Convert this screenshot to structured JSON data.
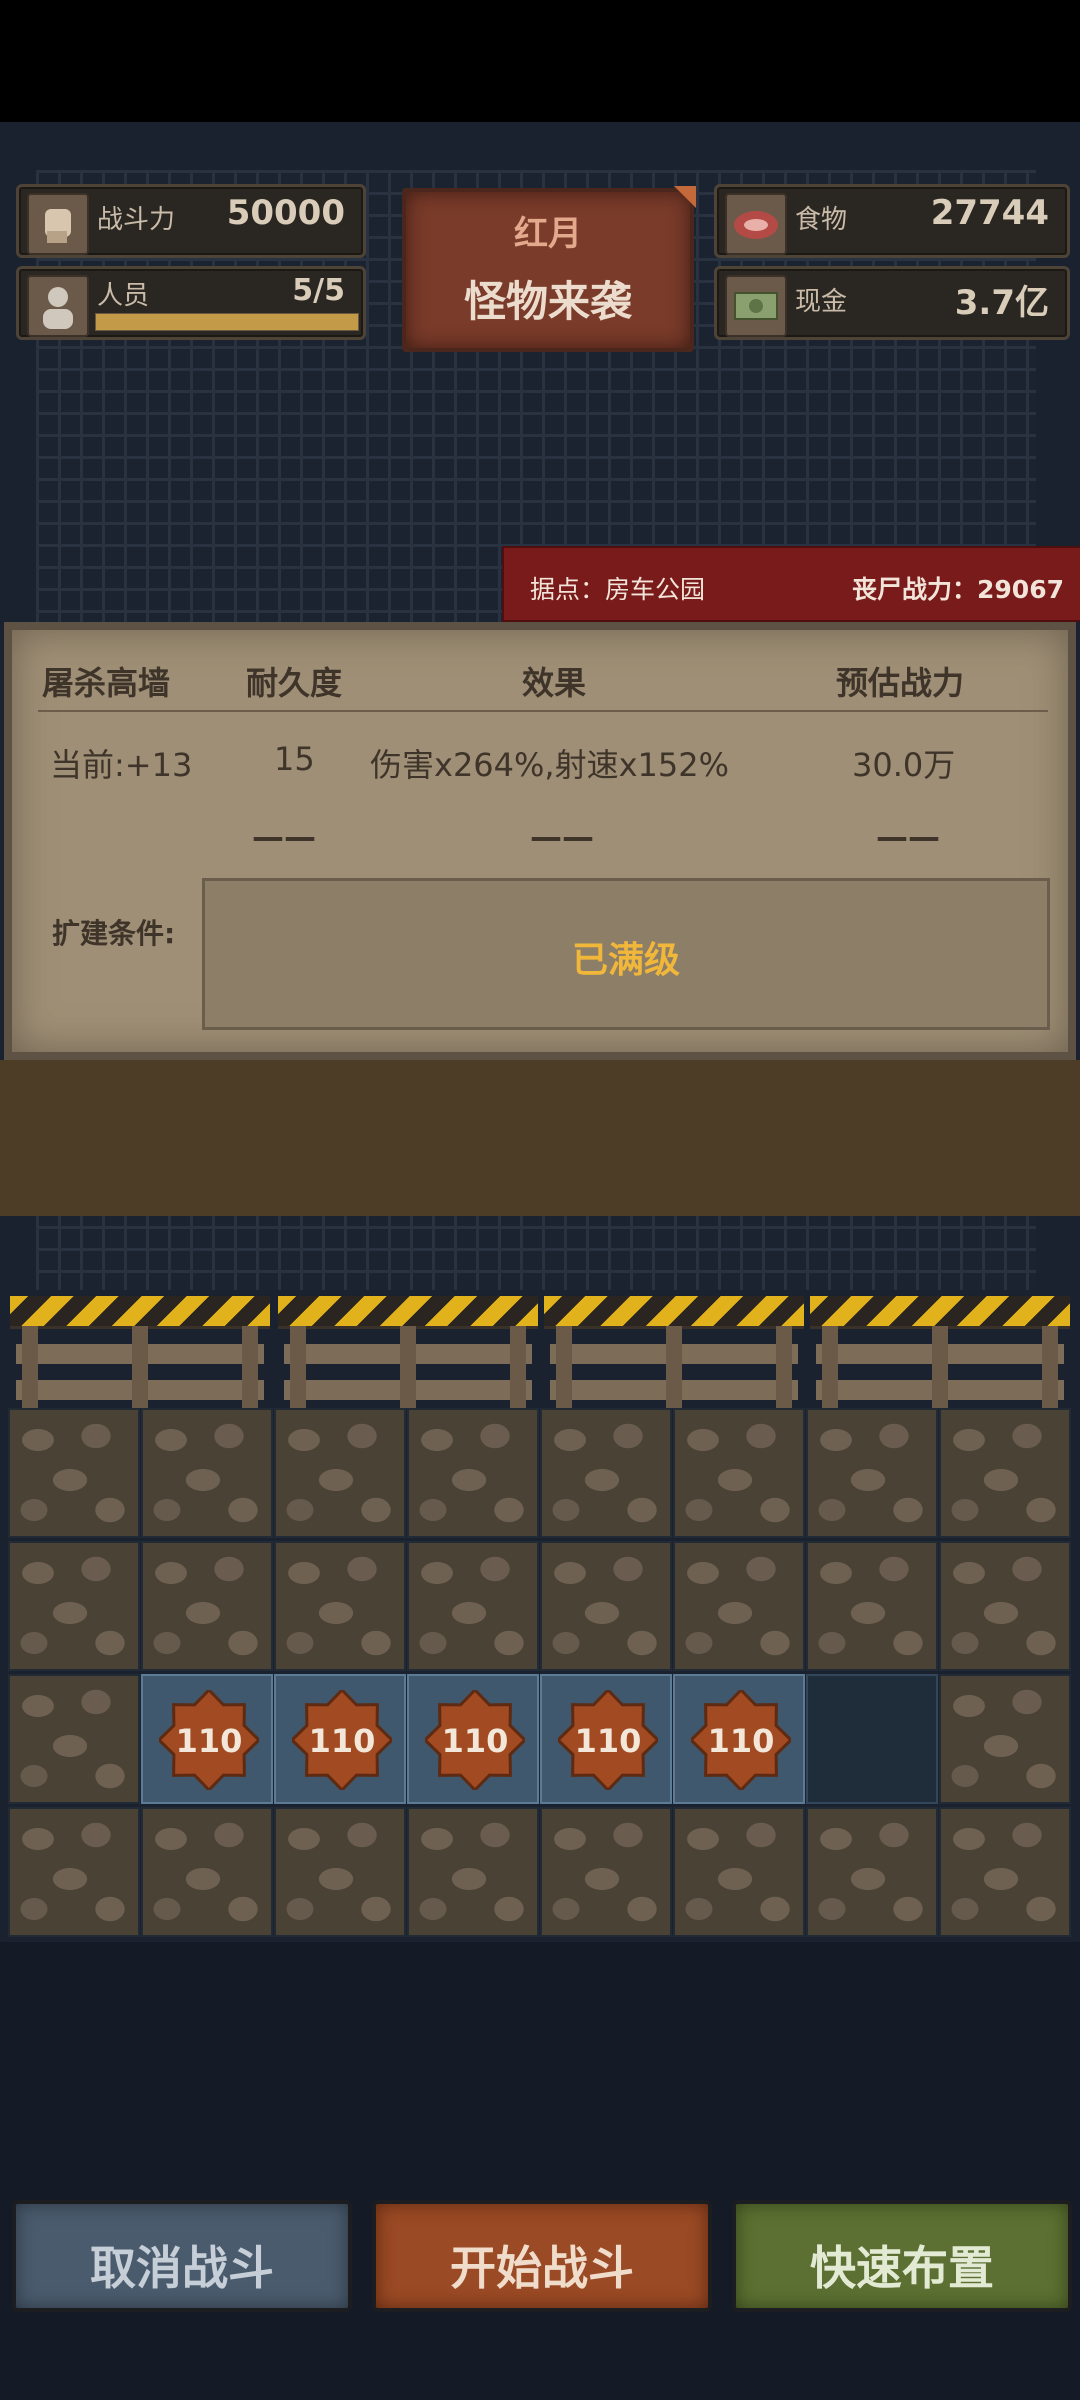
{
  "header": {
    "combat_power": {
      "label": "战斗力",
      "value": "50000"
    },
    "personnel": {
      "label": "人员",
      "value": "5/5",
      "progress": 1.0
    },
    "food": {
      "label": "食物",
      "value": "27744"
    },
    "cash": {
      "label": "现金",
      "value": "3.7亿"
    },
    "event": {
      "line1": "红月",
      "line2": "怪物来袭"
    }
  },
  "stronghold": {
    "location": "据点：房车公园",
    "zombie_power": "丧尸战力：29067"
  },
  "panel": {
    "headers": [
      "屠杀高墙",
      "耐久度",
      "效果",
      "预估战力"
    ],
    "current": {
      "level": "当前:+13",
      "durability": "15",
      "effect": "伤害x264%,射速x152%",
      "power": "30.0万"
    },
    "next": {
      "durability": "——",
      "effect": "——",
      "power": "——"
    },
    "expand_label": "扩建条件:",
    "max_level_text": "已满级"
  },
  "grid": {
    "badge_value": "110",
    "rows": [
      [
        "stone",
        "stone",
        "stone",
        "stone",
        "stone",
        "stone",
        "stone",
        "stone"
      ],
      [
        "stone",
        "stone",
        "stone",
        "stone",
        "stone",
        "stone",
        "stone",
        "stone"
      ],
      [
        "stone",
        "unit",
        "unit",
        "unit",
        "unit",
        "unit",
        "empty",
        "stone"
      ],
      [
        "stone",
        "stone",
        "stone",
        "stone",
        "stone",
        "stone",
        "stone",
        "stone"
      ]
    ]
  },
  "buttons": {
    "cancel": "取消战斗",
    "start": "开始战斗",
    "quick": "快速布置"
  },
  "colors": {
    "accent_gold": "#f1b73b",
    "badge_orange": "#a24a22",
    "stronghold_red": "#7a1b1b"
  }
}
